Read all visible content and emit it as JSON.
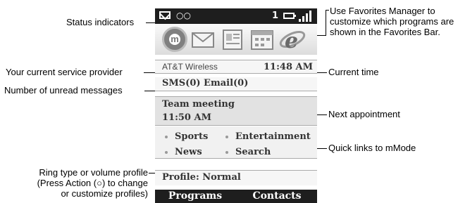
{
  "callouts": {
    "status_indicators": "Status indicators",
    "favorites_manager": "Use Favorites Manager to customize which programs are shown in the Favorites Bar.",
    "service_provider": "Your current service provider",
    "current_time": "Current time",
    "unread_messages": "Number of unread messages",
    "next_appointment": "Next appointment",
    "quick_links": "Quick links to mMode",
    "ring_type_line1": "Ring type or volume profile",
    "ring_type_line2": "(Press Action (○) to change",
    "ring_type_line3": "or customize profiles)"
  },
  "status_bar": {
    "icons": [
      "envelope-icon",
      "voicemail-icon",
      "battery-icon",
      "signal-icon"
    ],
    "voicemail_glyph": "○○",
    "line_number": "1"
  },
  "favorites_bar": {
    "icons": [
      "mmode-icon",
      "messaging-icon",
      "contacts-icon",
      "calendar-icon",
      "internet-explorer-icon"
    ],
    "mmode_glyph": "m"
  },
  "home": {
    "provider": "AT&T Wireless",
    "time": "11:48 AM",
    "unread": "SMS(0) Email(0)",
    "appointment_title": "Team meeting",
    "appointment_time": "11:50 AM",
    "links": [
      "Sports",
      "Entertainment",
      "News",
      "Search"
    ],
    "profile": "Profile: Normal"
  },
  "softkeys": {
    "left": "Programs",
    "right": "Contacts"
  },
  "colors": {
    "bar_dark": "#1e1e1e",
    "row_gray": "#e2e2e2",
    "ie_blue": "#2e6fc4"
  }
}
